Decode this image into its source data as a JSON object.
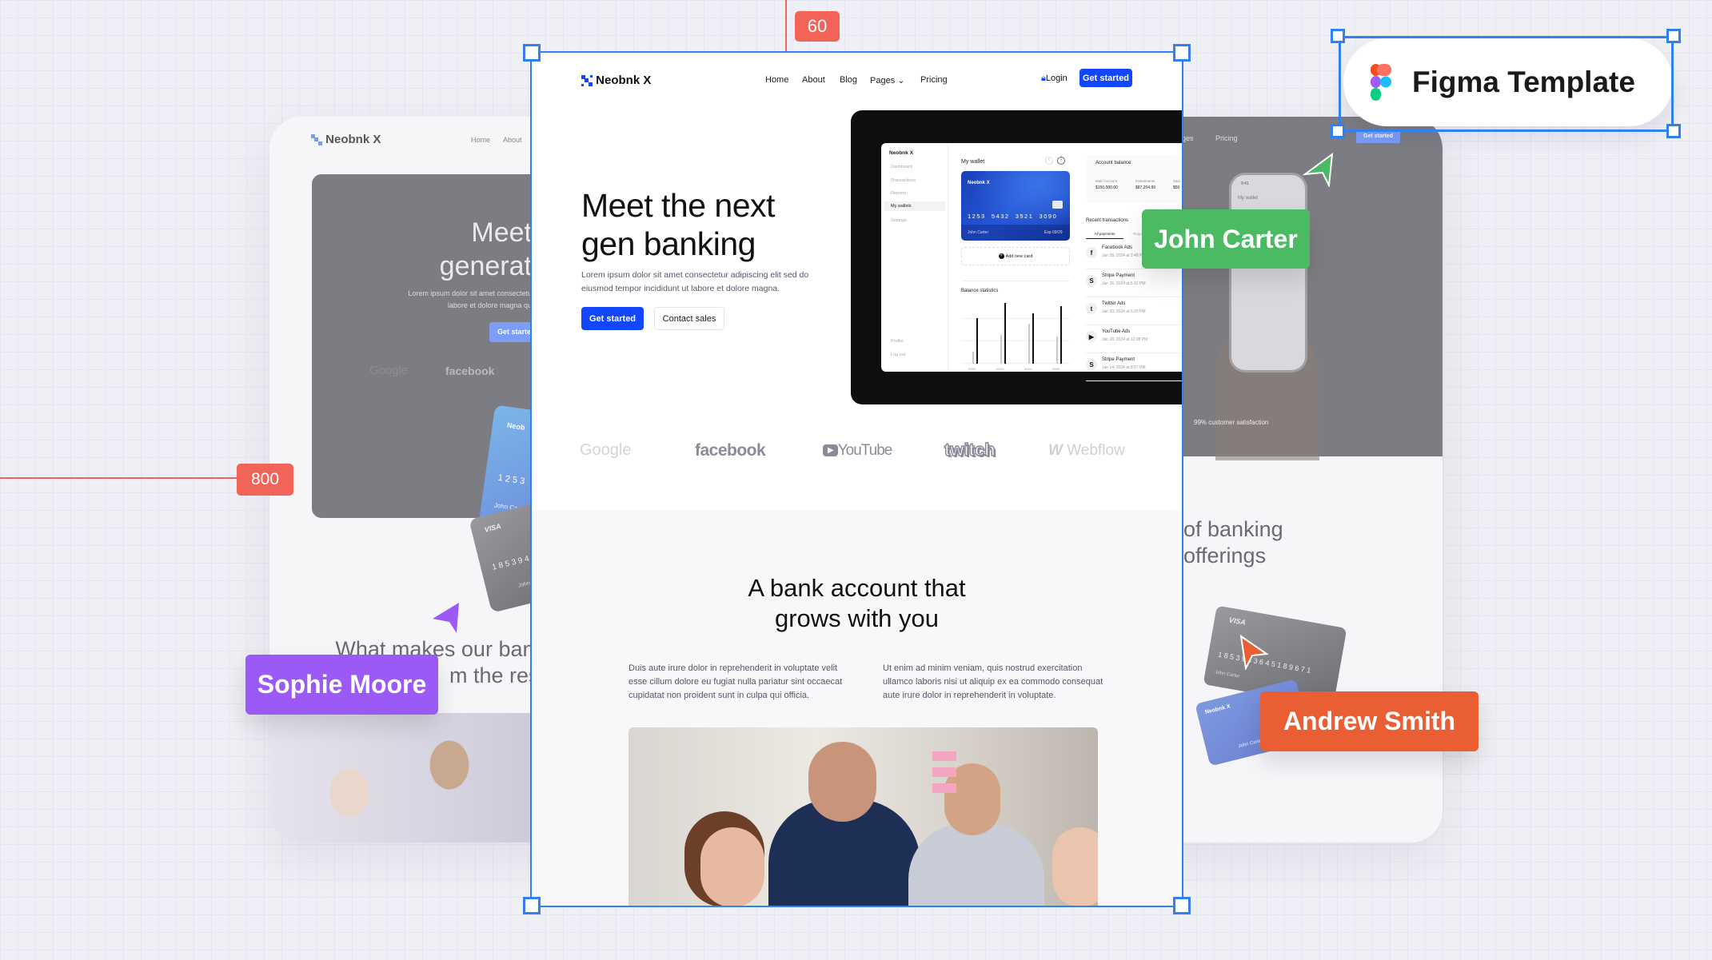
{
  "guides": {
    "top_value": "60",
    "left_value": "800",
    "guide_color": "#f26457"
  },
  "badge": {
    "label": "Figma Template",
    "icon": "figma-logo-icon"
  },
  "cursors": [
    {
      "name": "John Carter",
      "color": "#4cb963"
    },
    {
      "name": "Sophie Moore",
      "color": "#9b59f5"
    },
    {
      "name": "Andrew Smith",
      "color": "#ea5e33"
    }
  ],
  "left_card": {
    "brand": "Neobnk X",
    "nav": [
      "Home",
      "About"
    ],
    "hero_title_1": "Meet",
    "hero_title_2": "generat",
    "hero_text_1": "Lorem ipsum dolor sit amet consectetu",
    "hero_text_2": "labore et dolore magna qu",
    "cta": "Get starte",
    "logos": [
      "Google",
      "facebook"
    ],
    "card_brand": "Neob",
    "card_number": "1 2 5 3",
    "card_holder": "John Carter",
    "card2_brand": "VISA",
    "card2_number": "1 8 5 3  9 4",
    "section_title_1": "What makes our bank",
    "section_title_2": "m the rest"
  },
  "right_card": {
    "nav": [
      "ges",
      "Pricing"
    ],
    "cta": "Get started",
    "phone_time": "9:41",
    "phone_title": "My wallet",
    "stat": "99% customer satisfaction",
    "section_title_1": "of banking",
    "section_title_2": "offerings",
    "card_brand": "VISA",
    "card_number": "1 8 5 3   9 4 3 6   4 5 1 8   9 6 7 1",
    "card_holder": "John Carter",
    "card2_brand": "Neobnk X",
    "card2_holder": "John Carter"
  },
  "main": {
    "brand": "Neobnk X",
    "nav": [
      "Home",
      "About",
      "Blog",
      "Pages",
      "Pricing"
    ],
    "login": "Login",
    "get_started": "Get started",
    "hero_title_1": "Meet the next",
    "hero_title_2": "gen banking",
    "hero_text": "Lorem ipsum dolor sit amet consectetur adipiscing elit sed do eiusmod tempor incididunt ut labore et dolore magna.",
    "cta_primary": "Get started",
    "cta_secondary": "Contact sales",
    "brand_color": "#1346ff",
    "logos": [
      "Google",
      "facebook",
      "YouTube",
      "twitch",
      "Webflow"
    ],
    "dashboard": {
      "brand": "Neobnk X",
      "sidebar": [
        "Dashboard",
        "Transactions",
        "Reports",
        "My wallets",
        "Settings"
      ],
      "sidebar_active": "My wallets",
      "sidebar_bottom": [
        "Profile",
        "Log out"
      ],
      "wallet_title": "My wallet",
      "card": {
        "brand": "Neobnk X",
        "number": "1253  5432  3521  3090",
        "holder": "John Carter",
        "exp": "Exp 09/29"
      },
      "add_card": "Add new card",
      "stats_title": "Balance statistics",
      "chart": {
        "years": [
          "2022",
          "2023",
          "2024",
          "2025"
        ],
        "gray": [
          0.2,
          0.47,
          0.66,
          0.45
        ],
        "black": [
          0.75,
          1.0,
          0.83,
          0.95
        ]
      },
      "balance_title": "Account balance",
      "balances": [
        {
          "label": "Main Account",
          "value": "$150,580.00"
        },
        {
          "label": "Investments",
          "value": "$87,204.99"
        },
        {
          "label": "Savi",
          "value": "$50"
        }
      ],
      "recent_title": "Recent transactions",
      "tabs": [
        "All payments",
        "Regu"
      ],
      "transactions": [
        {
          "icon": "f",
          "name": "Facebook Ads",
          "date": "Jan 28, 2024 at 2:48 PM"
        },
        {
          "icon": "S",
          "name": "Stripe Payment",
          "date": "Jan 26, 2024 at 5:12 PM"
        },
        {
          "icon": "t",
          "name": "Twitter Ads",
          "date": "Jan 20, 2024 at 6:20 PM"
        },
        {
          "icon": "▶",
          "name": "YouTube Ads",
          "date": "Jan 18, 2024 at 12:08 PM"
        },
        {
          "icon": "S",
          "name": "Stripe Payment",
          "date": "Jan 14, 2024 at 8:57 PM"
        }
      ]
    },
    "section_title_1": "A bank account that",
    "section_title_2": "grows with you",
    "col1": "Duis aute irure dolor in reprehenderit in voluptate velit esse cillum dolore eu fugiat nulla pariatur sint occaecat cupidatat non proident sunt in culpa qui officia.",
    "col2": "Ut enim ad minim veniam, quis nostrud exercitation ullamco laboris nisi ut aliquip ex ea commodo consequat aute irure dolor in reprehenderit in voluptate."
  }
}
